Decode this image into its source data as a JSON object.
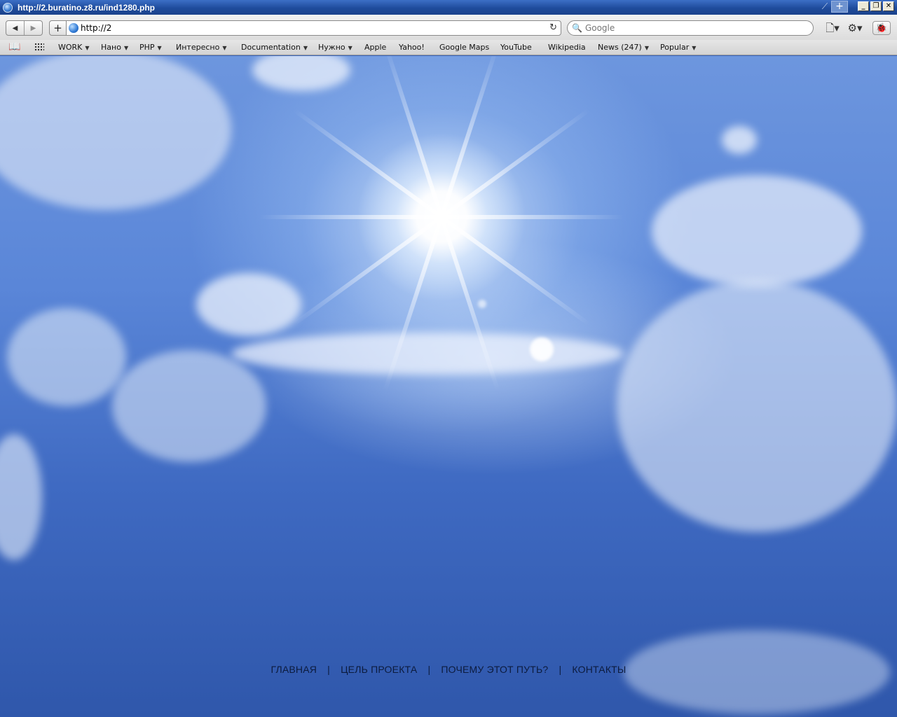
{
  "window": {
    "title": "http://2.buratino.z8.ru/ind1280.php",
    "new_tab_label": "+",
    "controls": {
      "minimize": "_",
      "maximize": "❐",
      "close": "✕"
    }
  },
  "toolbar": {
    "back_icon": "◀",
    "forward_icon": "▶",
    "add_bookmark_icon": "+",
    "url": "http://2",
    "reload_icon": "↻",
    "search_placeholder": "Google",
    "search_icon": "🔍",
    "page_menu_icon": "🗋▾",
    "settings_icon": "⚙▾",
    "bug_icon": "🐞"
  },
  "bookmarks": {
    "book_icon": "📖",
    "items": [
      {
        "label": "WORK",
        "menu": true
      },
      {
        "label": "Нано",
        "menu": true
      },
      {
        "label": "PHP",
        "menu": true
      },
      {
        "label": "Интересно",
        "menu": true
      },
      {
        "label": "Documentation",
        "menu": true
      },
      {
        "label": "Нужно",
        "menu": true
      },
      {
        "label": "Apple",
        "menu": false
      },
      {
        "label": "Yahoo!",
        "menu": false
      },
      {
        "label": "Google Maps",
        "menu": false
      },
      {
        "label": "YouTube",
        "menu": false
      },
      {
        "label": "Wikipedia",
        "menu": false
      },
      {
        "label": "News (247)",
        "menu": true
      },
      {
        "label": "Popular",
        "menu": true
      }
    ],
    "arrow": "▼"
  },
  "footer": {
    "links": [
      "ГЛАВНАЯ",
      "ЦЕЛЬ ПРОЕКТА",
      "ПОЧЕМУ ЭТОТ ПУТЬ?",
      "КОНТАКТЫ"
    ],
    "separator": "|"
  }
}
